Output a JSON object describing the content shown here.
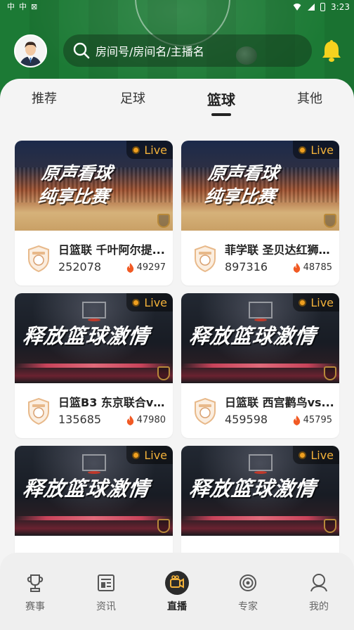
{
  "status_bar": {
    "left_icons": [
      "中",
      "中",
      "⊠"
    ],
    "time": "3:23"
  },
  "header": {
    "search_placeholder": "房间号/房间名/主播名",
    "avatar_icon": "user-avatar",
    "bell_icon": "bell-icon"
  },
  "tabs": [
    {
      "label": "推荐",
      "active": false
    },
    {
      "label": "足球",
      "active": false
    },
    {
      "label": "篮球",
      "active": true
    },
    {
      "label": "其他",
      "active": false
    }
  ],
  "live_badge": "Live",
  "cards": [
    {
      "promo": "原声看球\n纯享比赛",
      "title": "日篮联 千叶阿尔提...",
      "room_id": "252078",
      "heat": "49297"
    },
    {
      "promo": "原声看球\n纯享比赛",
      "title": "菲学联 圣贝达红狮v...",
      "room_id": "897316",
      "heat": "48785"
    },
    {
      "promo": "释放篮球激情",
      "title": "日篮B3 东京联合vs...",
      "room_id": "135685",
      "heat": "47980"
    },
    {
      "promo": "释放篮球激情",
      "title": "日篮联 西宫鹳鸟vs...",
      "room_id": "459598",
      "heat": "45795"
    },
    {
      "promo": "释放篮球激情",
      "title": "",
      "room_id": "",
      "heat": ""
    },
    {
      "promo": "释放篮球激情",
      "title": "",
      "room_id": "",
      "heat": ""
    }
  ],
  "bottom_nav": [
    {
      "label": "赛事",
      "icon": "trophy-icon",
      "active": false
    },
    {
      "label": "资讯",
      "icon": "news-icon",
      "active": false
    },
    {
      "label": "直播",
      "icon": "live-camera-icon",
      "active": true
    },
    {
      "label": "专家",
      "icon": "target-icon",
      "active": false
    },
    {
      "label": "我的",
      "icon": "profile-icon",
      "active": false
    }
  ],
  "colors": {
    "grass": "#1c7a35",
    "live_accent": "#f2b13a",
    "heat_flame": "#f15a24",
    "bell": "#f5d21e"
  }
}
